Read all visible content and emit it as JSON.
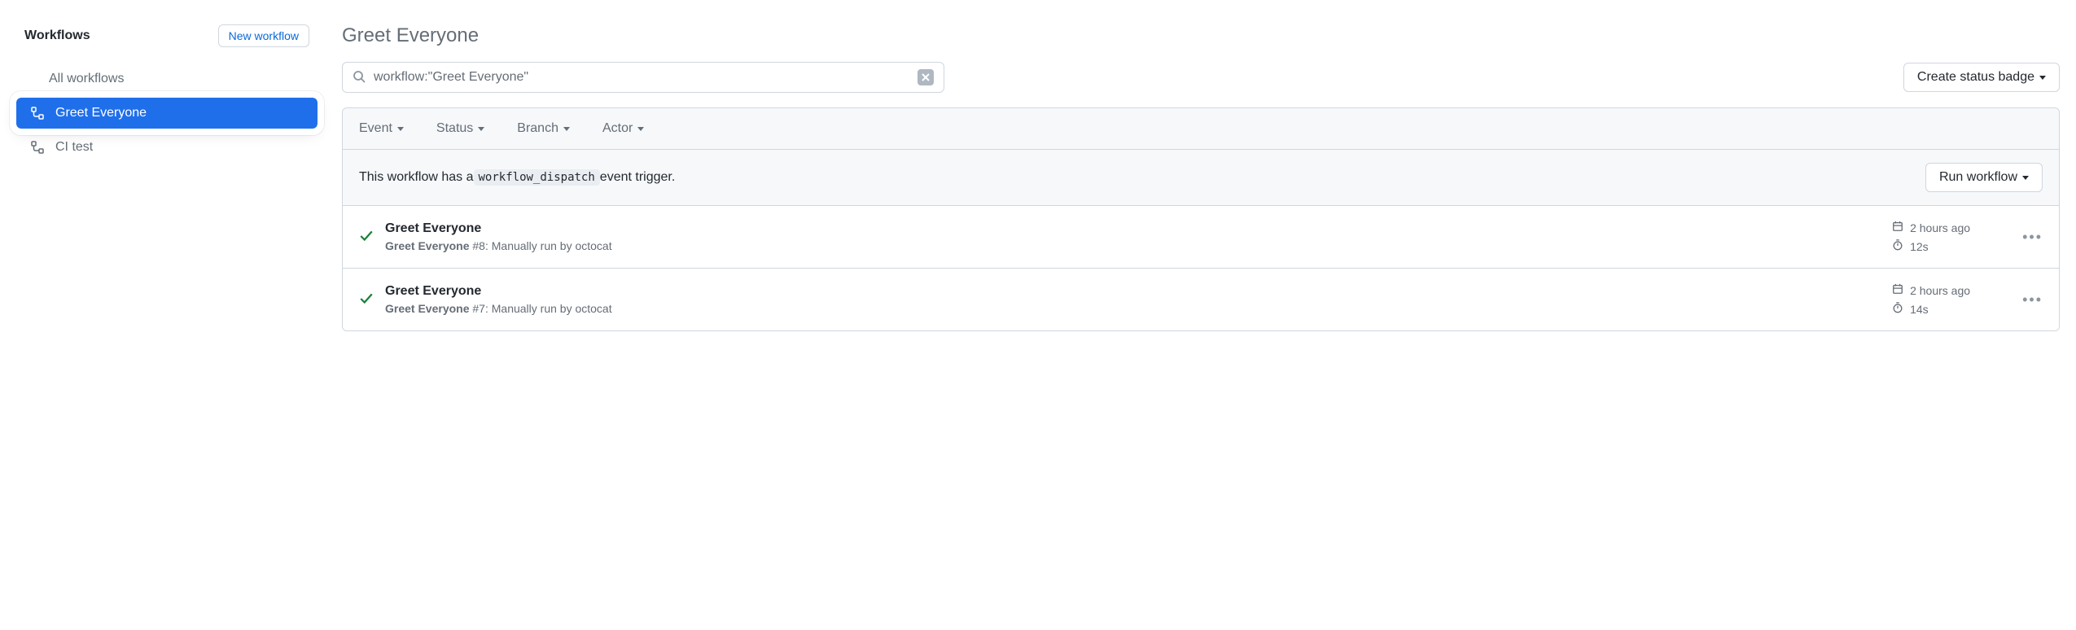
{
  "sidebar": {
    "title": "Workflows",
    "new_workflow_label": "New workflow",
    "all_label": "All workflows",
    "items": [
      {
        "label": "Greet Everyone",
        "selected": true
      },
      {
        "label": "CI test",
        "selected": false
      }
    ]
  },
  "header": {
    "page_title": "Greet Everyone"
  },
  "search": {
    "value": "workflow:\"Greet Everyone\""
  },
  "toolbar": {
    "create_status_badge_label": "Create status badge"
  },
  "filters": {
    "event": "Event",
    "status": "Status",
    "branch": "Branch",
    "actor": "Actor"
  },
  "dispatch": {
    "prefix": "This workflow has a ",
    "code": "workflow_dispatch",
    "suffix": " event trigger.",
    "run_label": "Run workflow"
  },
  "runs": [
    {
      "title": "Greet Everyone",
      "workflow": "Greet Everyone",
      "run_number": "#8",
      "detail": ": Manually run by octocat",
      "time": "2 hours ago",
      "duration": "12s"
    },
    {
      "title": "Greet Everyone",
      "workflow": "Greet Everyone",
      "run_number": "#7",
      "detail": ": Manually run by octocat",
      "time": "2 hours ago",
      "duration": "14s"
    }
  ]
}
